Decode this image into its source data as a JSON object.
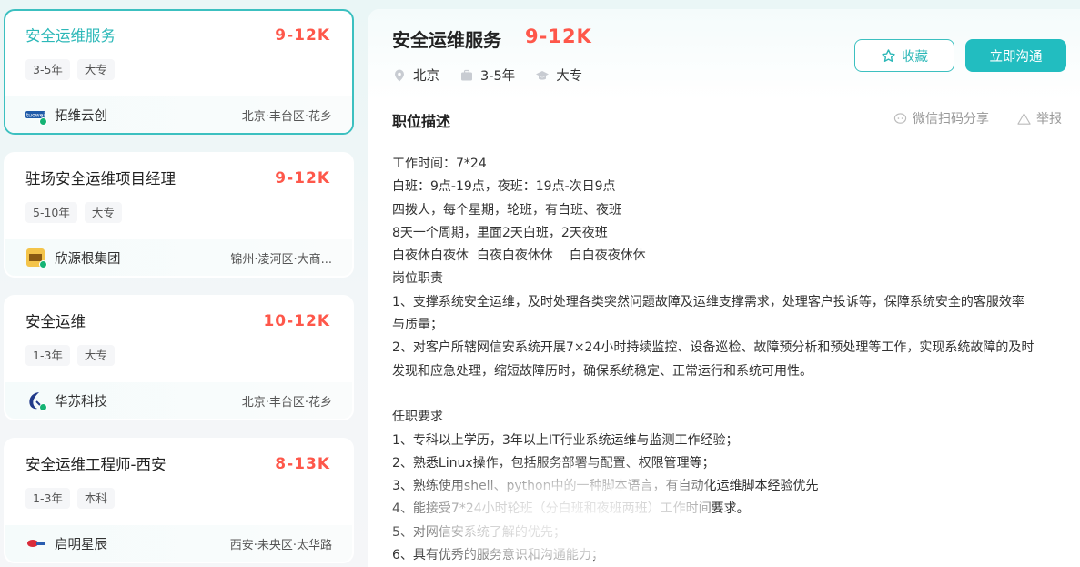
{
  "jobs": [
    {
      "title": "安全运维服务",
      "salary": "9-12K",
      "tags": [
        "3-5年",
        "大专"
      ],
      "company": "拓维云创",
      "location": "北京·丰台区·花乡",
      "logo_color": "#1e5aa8"
    },
    {
      "title": "驻场安全运维项目经理",
      "salary": "9-12K",
      "tags": [
        "5-10年",
        "大专"
      ],
      "company": "欣源根集团",
      "location": "锦州·凌河区·大商...",
      "logo_color": "#e8a21a"
    },
    {
      "title": "安全运维",
      "salary": "10-12K",
      "tags": [
        "1-3年",
        "大专"
      ],
      "company": "华苏科技",
      "location": "北京·丰台区·花乡",
      "logo_color": "#223a8a"
    },
    {
      "title": "安全运维工程师-西安",
      "salary": "8-13K",
      "tags": [
        "1-3年",
        "本科"
      ],
      "company": "启明星辰",
      "location": "西安·未央区·太华路",
      "logo_color": "#d92b3a"
    }
  ],
  "detail": {
    "title": "安全运维服务",
    "salary": "9-12K",
    "city": "北京",
    "experience": "3-5年",
    "degree": "大专",
    "fav_label": "收藏",
    "chat_label": "立即沟通",
    "section_title": "职位描述",
    "share_label": "微信扫码分享",
    "report_label": "举报",
    "description": [
      "工作时间：7*24",
      "白班：9点-19点，夜班：19点-次日9点",
      "四拨人，每个星期，轮班，有白班、夜班",
      "8天一个周期，里面2天白班，2天夜班",
      "白夜休白夜休  白夜白夜休休    白白夜夜休休",
      "岗位职责",
      "1、支撑系统安全运维，及时处理各类突然问题故障及运维支撑需求，处理客户投诉等，保障系统安全的客服效率",
      "与质量；",
      "2、对客户所辖网信安系统开展7×24小时持续监控、设备巡检、故障预分析和预处理等工作，实现系统故障的及时",
      "发现和应急处理，缩短故障历时，确保系统稳定、正常运行和系统可用性。",
      "",
      "任职要求",
      "1、专科以上学历，3年以上IT行业系统运维与监测工作经验；",
      "2、熟悉Linux操作，包括服务部署与配置、权限管理等；",
      "3、熟练使用shell、python中的一种脚本语言，有自动化运维脚本经验优先",
      "4、能接受7*24小时轮班（分白班和夜班两班）工作时间要求。",
      "5、对网信安系统了解的优先；",
      "6、具有优秀的服务意识和沟通能力；"
    ]
  },
  "colors": {
    "accent": "#22bdc0",
    "salary": "#fe574a"
  }
}
